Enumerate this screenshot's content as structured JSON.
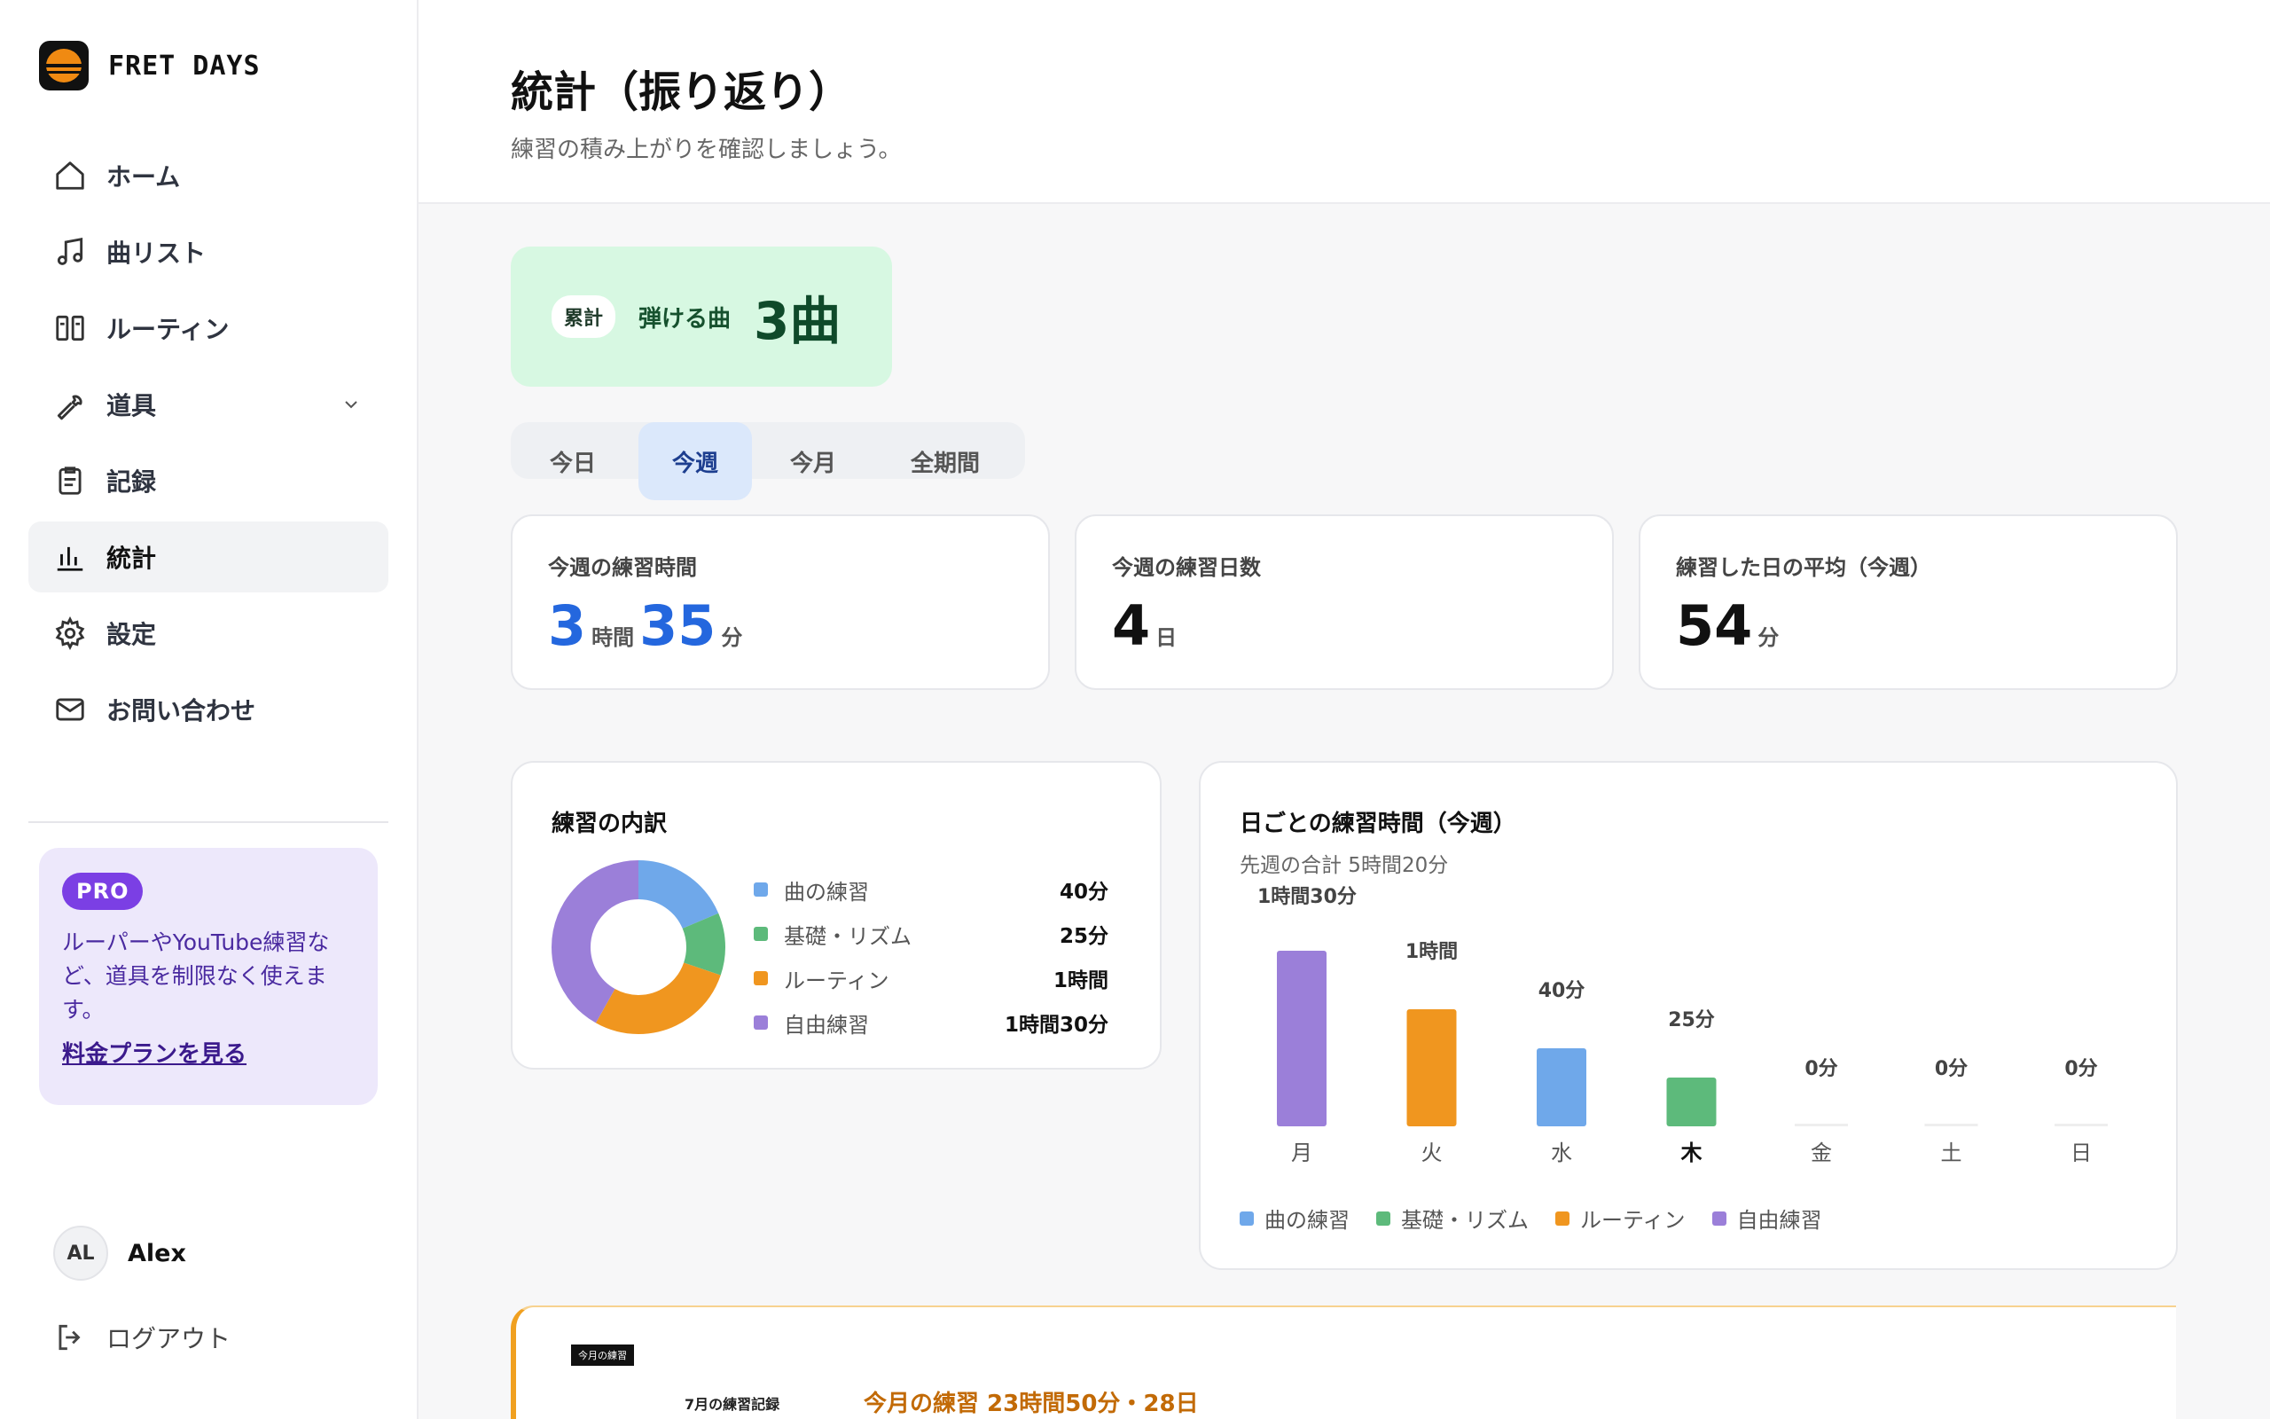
{
  "brand": {
    "name": "FRET DAYS"
  },
  "nav": [
    {
      "label": "ホーム",
      "icon": "home-icon"
    },
    {
      "label": "曲リスト",
      "icon": "music-note-icon"
    },
    {
      "label": "ルーティン",
      "icon": "columns-icon"
    },
    {
      "label": "道具",
      "icon": "wrench-icon",
      "has_chevron": true
    },
    {
      "label": "記録",
      "icon": "clipboard-icon"
    },
    {
      "label": "統計",
      "icon": "bar-chart-icon",
      "active": true
    },
    {
      "label": "設定",
      "icon": "gear-icon"
    },
    {
      "label": "お問い合わせ",
      "icon": "mail-icon"
    }
  ],
  "pro": {
    "badge": "PRO",
    "text": "ルーパーやYouTube練習など、道具を制限なく使えます。",
    "link": "料金プランを見る"
  },
  "user": {
    "initials": "AL",
    "name": "Alex"
  },
  "logout": {
    "label": "ログアウト"
  },
  "header": {
    "title": "統計（振り返り）",
    "subtitle": "練習の積み上がりを確認しましょう。"
  },
  "total": {
    "badge": "累計",
    "label": "弾ける曲",
    "value": "3曲"
  },
  "tabs": [
    {
      "label": "今日"
    },
    {
      "label": "今週",
      "active": true
    },
    {
      "label": "今月"
    },
    {
      "label": "全期間"
    }
  ],
  "stats": {
    "time": {
      "label": "今週の練習時間",
      "hours": "3",
      "hours_unit": "時間",
      "minutes": "35",
      "minutes_unit": "分"
    },
    "days": {
      "label": "今週の練習日数",
      "value": "4",
      "unit": "日"
    },
    "avg": {
      "label": "練習した日の平均（今週）",
      "value": "54",
      "unit": "分"
    }
  },
  "breakdown": {
    "title": "練習の内訳",
    "items": [
      {
        "name": "曲の練習",
        "value": "40分",
        "minutes": 40,
        "color": "#6fa8ea"
      },
      {
        "name": "基礎・リズム",
        "value": "25分",
        "minutes": 25,
        "color": "#5dba7b"
      },
      {
        "name": "ルーティン",
        "value": "1時間",
        "minutes": 60,
        "color": "#f0961f"
      },
      {
        "name": "自由練習",
        "value": "1時間30分",
        "minutes": 90,
        "color": "#9b7fd9"
      }
    ]
  },
  "daily": {
    "title": "日ごとの練習時間（今週）",
    "subtitle": "先週の合計 5時間20分",
    "max_label": "1時間30分"
  },
  "chart_data": {
    "type": "bar",
    "categories": [
      "月",
      "火",
      "水",
      "木",
      "金",
      "土",
      "日"
    ],
    "values": [
      90,
      60,
      40,
      25,
      0,
      0,
      0
    ],
    "value_labels": [
      "1時間30分",
      "1時間",
      "40分",
      "25分",
      "0分",
      "0分",
      "0分"
    ],
    "bar_colors": [
      "#9b7fd9",
      "#f0961f",
      "#6fa8ea",
      "#5dba7b",
      "#eeeeee",
      "#eeeeee",
      "#eeeeee"
    ],
    "ylim": [
      0,
      90
    ],
    "legend": [
      "曲の練習",
      "基礎・リズム",
      "ルーティン",
      "自由練習"
    ],
    "legend_colors": [
      "#6fa8ea",
      "#5dba7b",
      "#f0961f",
      "#9b7fd9"
    ],
    "legend_position": "bottom",
    "highlight_category": "木"
  },
  "month": {
    "tag": "今月の練習",
    "small_label": "7月の練習記録",
    "summary": "今月の練習 23時間50分・28日"
  }
}
